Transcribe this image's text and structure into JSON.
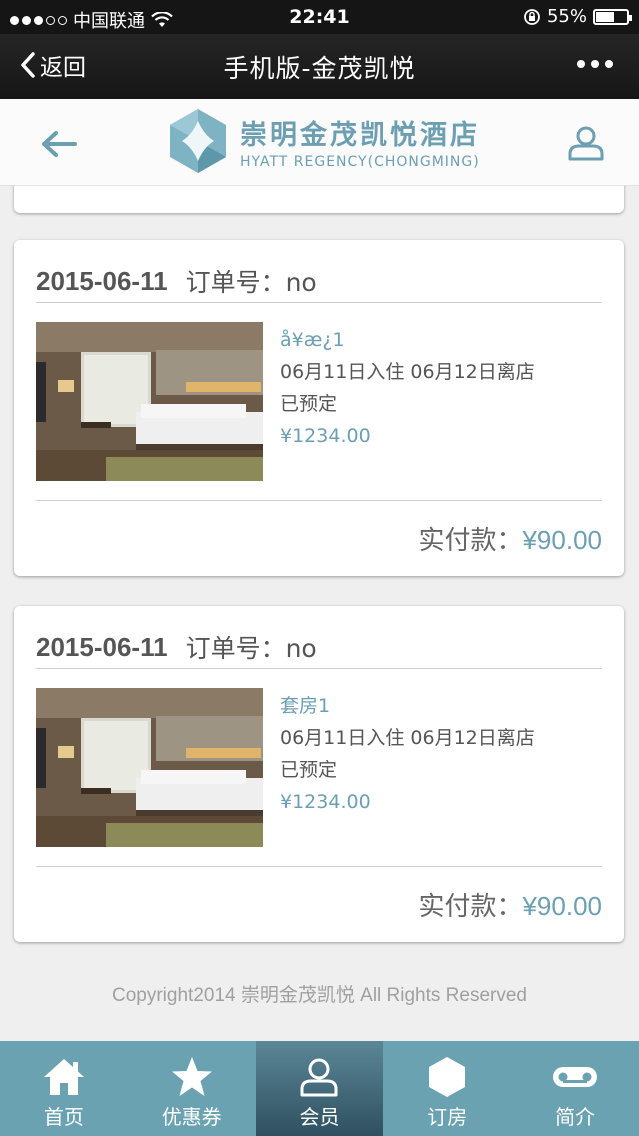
{
  "status_bar": {
    "carrier": "中国联通",
    "time": "22:41",
    "battery": "55%"
  },
  "nav": {
    "back_label": "返回",
    "title": "手机版-金茂凯悦"
  },
  "hotel": {
    "name_cn": "崇明金茂凯悦酒店",
    "name_en": "HYATT REGENCY(CHONGMING)"
  },
  "orders": [
    {
      "date": "2015-06-11",
      "order_no": "订单号：no",
      "room": "å¥æ¿1",
      "stay": "06月11日入住 06月12日离店",
      "status": "已预定",
      "price": "¥1234.00",
      "paid_label": "实付款：",
      "paid_amount": "¥90.00"
    },
    {
      "date": "2015-06-11",
      "order_no": "订单号：no",
      "room": "套房1",
      "stay": "06月11日入住 06月12日离店",
      "status": "已预定",
      "price": "¥1234.00",
      "paid_label": "实付款：",
      "paid_amount": "¥90.00"
    }
  ],
  "footer": {
    "copyright": "Copyright2014 崇明金茂凯悦 All Rights Reserved"
  },
  "tabs": [
    {
      "label": "首页",
      "icon": "home-icon"
    },
    {
      "label": "优惠券",
      "icon": "star-icon"
    },
    {
      "label": "会员",
      "icon": "user-icon"
    },
    {
      "label": "订房",
      "icon": "hexagon-icon"
    },
    {
      "label": "简介",
      "icon": "voicemail-icon"
    }
  ],
  "colors": {
    "accent": "#6aa2b2",
    "tab_active": "#3d6272",
    "nav_bg": "#1c1c1c"
  }
}
